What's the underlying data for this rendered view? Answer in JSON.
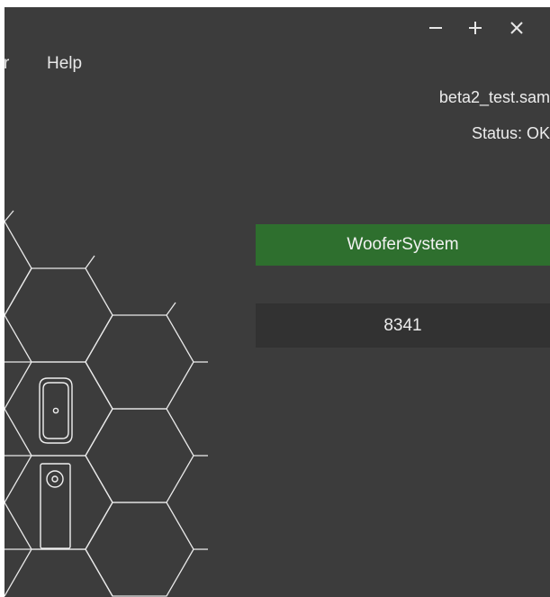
{
  "window": {
    "controls": {
      "minimize_icon": "minimize-icon",
      "maximize_icon": "plus-icon",
      "close_icon": "close-icon"
    }
  },
  "menu": {
    "items": [
      {
        "label": "r"
      },
      {
        "label": "Help"
      }
    ]
  },
  "file": {
    "name": "beta2_test.sam",
    "status": "Status: OK"
  },
  "system": {
    "button_label": "WooferSystem",
    "value": "8341"
  },
  "hex_panel": {
    "icons": [
      "woofer-speaker-icon",
      "tall-speaker-icon"
    ]
  },
  "colors": {
    "background": "#3c3c3c",
    "accent_green": "#2e6f2e",
    "value_box": "#323232",
    "text": "#ececec"
  }
}
